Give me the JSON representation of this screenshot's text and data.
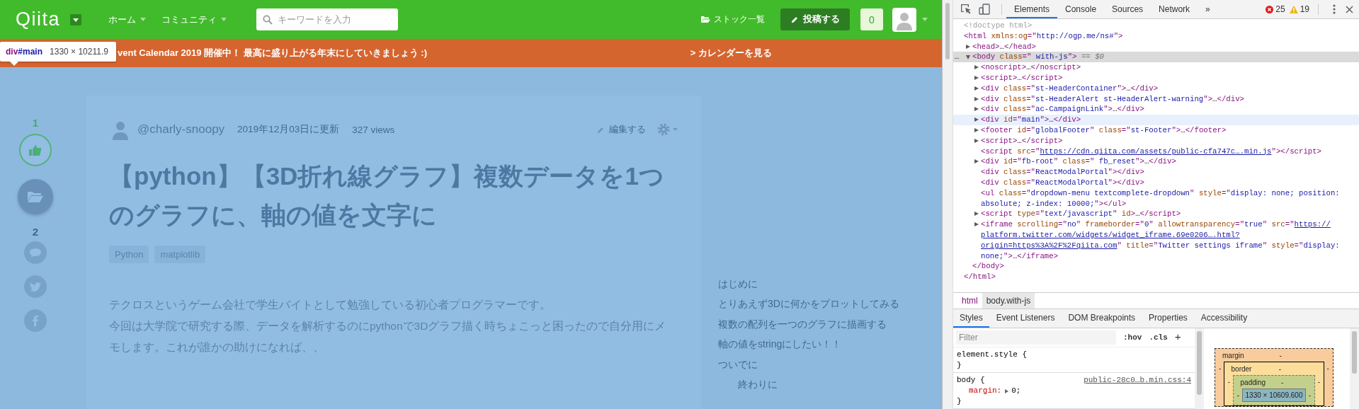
{
  "page": {
    "header": {
      "logo": "Qiita",
      "nav": [
        {
          "label": "ホーム"
        },
        {
          "label": "コミュニティ"
        }
      ],
      "search": {
        "placeholder": "キーワードを入力"
      },
      "stock_link": "ストック一覧",
      "post_button": "投稿する",
      "notification_count": "0"
    },
    "banner": {
      "message": "vent Calendar 2019 開催中！ 最高に盛り上がる年末にしていきましょう :)",
      "link": "> カレンダーを見る"
    },
    "inspect_tooltip": {
      "tag": "div",
      "id": "#main",
      "size": "1330 × 10211.9"
    },
    "actions": {
      "like_count": "1",
      "comment_count": "2"
    },
    "article": {
      "author": "@charly-snoopy",
      "updated": "2019年12月03日に更新",
      "views": "327 views",
      "edit": "編集する",
      "title": "【python】【3D折れ線グラフ】複数データを1つのグラフに、軸の値を文字に",
      "tags": [
        "Python",
        "matplotlib"
      ],
      "paragraphs": [
        "テクロスというゲーム会社で学生バイトとして勉強している初心者プログラマーです。",
        "今回は大学院で研究する際、データを解析するのにpythonで3Dグラフ描く時ちょこっと困ったので自分用にメモします。これが誰かの助けになれば、、"
      ]
    },
    "toc": [
      {
        "label": "はじめに"
      },
      {
        "label": "とりあえず3Dに何かをプロットしてみる"
      },
      {
        "label": "複数の配列を一つのグラフに描画する"
      },
      {
        "label": "軸の値をstringにしたい！！"
      },
      {
        "label": "ついでに",
        "children": [
          {
            "label": "終わりに"
          }
        ]
      }
    ]
  },
  "devtools": {
    "tabs": [
      {
        "label": "Elements",
        "selected": true
      },
      {
        "label": "Console",
        "selected": false
      },
      {
        "label": "Sources",
        "selected": false
      },
      {
        "label": "Network",
        "selected": false
      }
    ],
    "more": "»",
    "errors": "25",
    "warnings": "19",
    "dom": [
      {
        "selected": false,
        "hovered": false,
        "lines": [
          [
            {
              "kind": "dim",
              "text": "<!doctype html>"
            }
          ]
        ]
      },
      {
        "selected": false,
        "hovered": false,
        "lines": [
          [
            {
              "kind": "tag",
              "text": "<html"
            },
            {
              "kind": "attr",
              "text": " xmlns:og"
            },
            {
              "kind": "tag",
              "text": "=\""
            },
            {
              "kind": "val",
              "text": "http://ogp.me/ns#"
            },
            {
              "kind": "tag",
              "text": "\">"
            }
          ]
        ],
        "close": [
          {
            "kind": "tag",
            "text": "</html>"
          }
        ],
        "children": [
          {
            "selected": false,
            "hovered": false,
            "expanded": false,
            "lines": [
              [
                {
                  "kind": "tag",
                  "text": "<head>"
                },
                {
                  "kind": "text",
                  "text": "…"
                },
                {
                  "kind": "tag",
                  "text": "</head>"
                }
              ]
            ]
          },
          {
            "selected": true,
            "hovered": false,
            "expanded": true,
            "gutter": "…",
            "lines": [
              [
                {
                  "kind": "tag",
                  "text": "<body"
                },
                {
                  "kind": "attr",
                  "text": " class"
                },
                {
                  "kind": "tag",
                  "text": "=\""
                },
                {
                  "kind": "val",
                  "text": " with-js"
                },
                {
                  "kind": "tag",
                  "text": "\">"
                },
                {
                  "kind": "note",
                  "text": " == $0"
                }
              ]
            ],
            "close": [
              {
                "kind": "tag",
                "text": "</body>"
              }
            ],
            "children": [
              {
                "selected": false,
                "hovered": false,
                "expanded": false,
                "lines": [
                  [
                    {
                      "kind": "tag",
                      "text": "<noscript>"
                    },
                    {
                      "kind": "text",
                      "text": "…"
                    },
                    {
                      "kind": "tag",
                      "text": "</noscript>"
                    }
                  ]
                ]
              },
              {
                "selected": false,
                "hovered": false,
                "expanded": false,
                "lines": [
                  [
                    {
                      "kind": "tag",
                      "text": "<script>"
                    },
                    {
                      "kind": "text",
                      "text": "…"
                    },
                    {
                      "kind": "tag",
                      "text": "</script>"
                    }
                  ]
                ]
              },
              {
                "selected": false,
                "hovered": false,
                "expanded": false,
                "lines": [
                  [
                    {
                      "kind": "tag",
                      "text": "<div"
                    },
                    {
                      "kind": "attr",
                      "text": " class"
                    },
                    {
                      "kind": "tag",
                      "text": "=\""
                    },
                    {
                      "kind": "val",
                      "text": "st-HeaderContainer"
                    },
                    {
                      "kind": "tag",
                      "text": "\">"
                    },
                    {
                      "kind": "text",
                      "text": "…"
                    },
                    {
                      "kind": "tag",
                      "text": "</div>"
                    }
                  ]
                ]
              },
              {
                "selected": false,
                "hovered": false,
                "expanded": false,
                "lines": [
                  [
                    {
                      "kind": "tag",
                      "text": "<div"
                    },
                    {
                      "kind": "attr",
                      "text": " class"
                    },
                    {
                      "kind": "tag",
                      "text": "=\""
                    },
                    {
                      "kind": "val",
                      "text": "st-HeaderAlert st-HeaderAlert-warning"
                    },
                    {
                      "kind": "tag",
                      "text": "\">"
                    },
                    {
                      "kind": "text",
                      "text": "…"
                    },
                    {
                      "kind": "tag",
                      "text": "</div>"
                    }
                  ]
                ]
              },
              {
                "selected": false,
                "hovered": false,
                "expanded": false,
                "lines": [
                  [
                    {
                      "kind": "tag",
                      "text": "<div"
                    },
                    {
                      "kind": "attr",
                      "text": " class"
                    },
                    {
                      "kind": "tag",
                      "text": "=\""
                    },
                    {
                      "kind": "val",
                      "text": "ac-CampaignLink"
                    },
                    {
                      "kind": "tag",
                      "text": "\">"
                    },
                    {
                      "kind": "text",
                      "text": "…"
                    },
                    {
                      "kind": "tag",
                      "text": "</div>"
                    }
                  ]
                ]
              },
              {
                "selected": false,
                "hovered": true,
                "expanded": false,
                "lines": [
                  [
                    {
                      "kind": "tag",
                      "text": "<div"
                    },
                    {
                      "kind": "attr",
                      "text": " id"
                    },
                    {
                      "kind": "tag",
                      "text": "=\""
                    },
                    {
                      "kind": "val",
                      "text": "main"
                    },
                    {
                      "kind": "tag",
                      "text": "\">"
                    },
                    {
                      "kind": "text",
                      "text": "…"
                    },
                    {
                      "kind": "tag",
                      "text": "</div>"
                    }
                  ]
                ]
              },
              {
                "selected": false,
                "hovered": false,
                "expanded": false,
                "lines": [
                  [
                    {
                      "kind": "tag",
                      "text": "<footer"
                    },
                    {
                      "kind": "attr",
                      "text": " id"
                    },
                    {
                      "kind": "tag",
                      "text": "=\""
                    },
                    {
                      "kind": "val",
                      "text": "globalFooter"
                    },
                    {
                      "kind": "tag",
                      "text": "\""
                    },
                    {
                      "kind": "attr",
                      "text": " class"
                    },
                    {
                      "kind": "tag",
                      "text": "=\""
                    },
                    {
                      "kind": "val",
                      "text": "st-Footer"
                    },
                    {
                      "kind": "tag",
                      "text": "\">"
                    },
                    {
                      "kind": "text",
                      "text": "…"
                    },
                    {
                      "kind": "tag",
                      "text": "</footer>"
                    }
                  ]
                ]
              },
              {
                "selected": false,
                "hovered": false,
                "expanded": false,
                "lines": [
                  [
                    {
                      "kind": "tag",
                      "text": "<script>"
                    },
                    {
                      "kind": "text",
                      "text": "…"
                    },
                    {
                      "kind": "tag",
                      "text": "</script>"
                    }
                  ]
                ]
              },
              {
                "selected": false,
                "hovered": false,
                "lines": [
                  [
                    {
                      "kind": "tag",
                      "text": "<script"
                    },
                    {
                      "kind": "attr",
                      "text": " src"
                    },
                    {
                      "kind": "tag",
                      "text": "=\""
                    },
                    {
                      "kind": "link",
                      "text": "https://cdn.qiita.com/assets/public-cfa747c….min.js"
                    },
                    {
                      "kind": "tag",
                      "text": "\"></script>"
                    }
                  ]
                ]
              },
              {
                "selected": false,
                "hovered": false,
                "expanded": false,
                "lines": [
                  [
                    {
                      "kind": "tag",
                      "text": "<div"
                    },
                    {
                      "kind": "attr",
                      "text": " id"
                    },
                    {
                      "kind": "tag",
                      "text": "=\""
                    },
                    {
                      "kind": "val",
                      "text": "fb-root"
                    },
                    {
                      "kind": "tag",
                      "text": "\""
                    },
                    {
                      "kind": "attr",
                      "text": " class"
                    },
                    {
                      "kind": "tag",
                      "text": "=\""
                    },
                    {
                      "kind": "val",
                      "text": " fb_reset"
                    },
                    {
                      "kind": "tag",
                      "text": "\">"
                    },
                    {
                      "kind": "text",
                      "text": "…"
                    },
                    {
                      "kind": "tag",
                      "text": "</div>"
                    }
                  ]
                ]
              },
              {
                "selected": false,
                "hovered": false,
                "lines": [
                  [
                    {
                      "kind": "tag",
                      "text": "<div"
                    },
                    {
                      "kind": "attr",
                      "text": " class"
                    },
                    {
                      "kind": "tag",
                      "text": "=\""
                    },
                    {
                      "kind": "val",
                      "text": "ReactModalPortal"
                    },
                    {
                      "kind": "tag",
                      "text": "\"></div>"
                    }
                  ]
                ]
              },
              {
                "selected": false,
                "hovered": false,
                "lines": [
                  [
                    {
                      "kind": "tag",
                      "text": "<div"
                    },
                    {
                      "kind": "attr",
                      "text": " class"
                    },
                    {
                      "kind": "tag",
                      "text": "=\""
                    },
                    {
                      "kind": "val",
                      "text": "ReactModalPortal"
                    },
                    {
                      "kind": "tag",
                      "text": "\"></div>"
                    }
                  ]
                ]
              },
              {
                "selected": false,
                "hovered": false,
                "lines": [
                  [
                    {
                      "kind": "tag",
                      "text": "<ul"
                    },
                    {
                      "kind": "attr",
                      "text": " class"
                    },
                    {
                      "kind": "tag",
                      "text": "=\""
                    },
                    {
                      "kind": "val",
                      "text": "dropdown-menu textcomplete-dropdown"
                    },
                    {
                      "kind": "tag",
                      "text": "\""
                    },
                    {
                      "kind": "attr",
                      "text": " style"
                    },
                    {
                      "kind": "tag",
                      "text": "=\""
                    },
                    {
                      "kind": "val",
                      "text": "display: none; position:"
                    }
                  ],
                  [
                    {
                      "kind": "val",
                      "text": "absolute; z-index: 10000;"
                    },
                    {
                      "kind": "tag",
                      "text": "\"></ul>"
                    }
                  ]
                ]
              },
              {
                "selected": false,
                "hovered": false,
                "expanded": false,
                "lines": [
                  [
                    {
                      "kind": "tag",
                      "text": "<script"
                    },
                    {
                      "kind": "attr",
                      "text": " type"
                    },
                    {
                      "kind": "tag",
                      "text": "=\""
                    },
                    {
                      "kind": "val",
                      "text": "text/javascript"
                    },
                    {
                      "kind": "tag",
                      "text": "\""
                    },
                    {
                      "kind": "attr",
                      "text": " id"
                    },
                    {
                      "kind": "tag",
                      "text": ">"
                    },
                    {
                      "kind": "text",
                      "text": "…"
                    },
                    {
                      "kind": "tag",
                      "text": "</script>"
                    }
                  ]
                ]
              },
              {
                "selected": false,
                "hovered": false,
                "expanded": false,
                "lines": [
                  [
                    {
                      "kind": "tag",
                      "text": "<iframe"
                    },
                    {
                      "kind": "attr",
                      "text": " scrolling"
                    },
                    {
                      "kind": "tag",
                      "text": "=\""
                    },
                    {
                      "kind": "val",
                      "text": "no"
                    },
                    {
                      "kind": "tag",
                      "text": "\""
                    },
                    {
                      "kind": "attr",
                      "text": " frameborder"
                    },
                    {
                      "kind": "tag",
                      "text": "=\""
                    },
                    {
                      "kind": "val",
                      "text": "0"
                    },
                    {
                      "kind": "tag",
                      "text": "\""
                    },
                    {
                      "kind": "attr",
                      "text": " allowtransparency"
                    },
                    {
                      "kind": "tag",
                      "text": "=\""
                    },
                    {
                      "kind": "val",
                      "text": "true"
                    },
                    {
                      "kind": "tag",
                      "text": "\""
                    },
                    {
                      "kind": "attr",
                      "text": " src"
                    },
                    {
                      "kind": "tag",
                      "text": "=\""
                    },
                    {
                      "kind": "link",
                      "text": "https://"
                    }
                  ],
                  [
                    {
                      "kind": "link",
                      "text": "platform.twitter.com/widgets/widget_iframe.69e0206….html?"
                    }
                  ],
                  [
                    {
                      "kind": "link",
                      "text": "origin=https%3A%2F%2Fqiita.com"
                    },
                    {
                      "kind": "tag",
                      "text": "\""
                    },
                    {
                      "kind": "attr",
                      "text": " title"
                    },
                    {
                      "kind": "tag",
                      "text": "=\""
                    },
                    {
                      "kind": "val",
                      "text": "Twitter settings iframe"
                    },
                    {
                      "kind": "tag",
                      "text": "\""
                    },
                    {
                      "kind": "attr",
                      "text": " style"
                    },
                    {
                      "kind": "tag",
                      "text": "=\""
                    },
                    {
                      "kind": "val",
                      "text": "display:"
                    }
                  ],
                  [
                    {
                      "kind": "val",
                      "text": "none;"
                    },
                    {
                      "kind": "tag",
                      "text": "\">"
                    },
                    {
                      "kind": "text",
                      "text": "…"
                    },
                    {
                      "kind": "tag",
                      "text": "</iframe>"
                    }
                  ]
                ]
              }
            ]
          }
        ]
      }
    ],
    "breadcrumbs": [
      {
        "label": "html",
        "selected": false
      },
      {
        "label": "body.with-js",
        "selected": true
      }
    ],
    "style_tabs": [
      {
        "label": "Styles",
        "selected": true
      },
      {
        "label": "Event Listeners",
        "selected": false
      },
      {
        "label": "DOM Breakpoints",
        "selected": false
      },
      {
        "label": "Properties",
        "selected": false
      },
      {
        "label": "Accessibility",
        "selected": false
      }
    ],
    "filter": {
      "placeholder": "Filter"
    },
    "hov": ":hov",
    "cls": ".cls",
    "add": "+",
    "rules": [
      {
        "selector": "element.style {",
        "close": "}"
      },
      {
        "selector": "body {",
        "source": "public-28c0…b.min.css:4",
        "declarations": [
          {
            "property": "margin:",
            "value": "0;"
          }
        ],
        "close": "}"
      }
    ],
    "box_model": {
      "margin": {
        "label": "margin",
        "top": "-",
        "left": "-",
        "right": "-"
      },
      "border": {
        "label": "border",
        "top": "-",
        "left": "-",
        "right": "-"
      },
      "padding": {
        "label": "padding",
        "top": "-",
        "left": "-",
        "right": "-"
      },
      "content": "1330 × 10609.600"
    }
  }
}
